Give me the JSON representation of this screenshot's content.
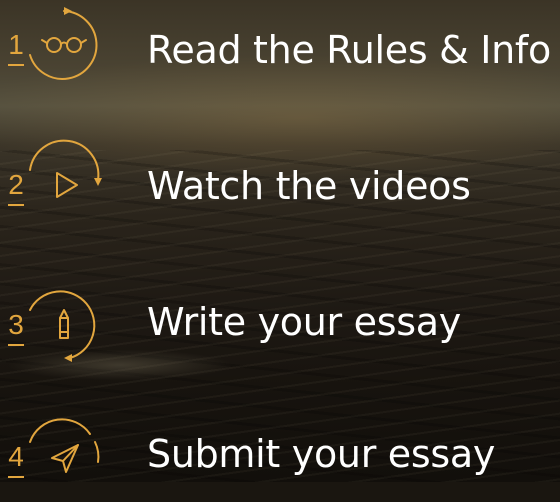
{
  "steps": [
    {
      "number": "1",
      "label": "Read the Rules & Info",
      "icon": "glasses-icon"
    },
    {
      "number": "2",
      "label": "Watch the videos",
      "icon": "play-icon"
    },
    {
      "number": "3",
      "label": "Write your essay",
      "icon": "pencil-icon"
    },
    {
      "number": "4",
      "label": "Submit your essay",
      "icon": "send-icon"
    }
  ],
  "colors": {
    "accent": "#e2a63e",
    "text": "#ffffff"
  }
}
